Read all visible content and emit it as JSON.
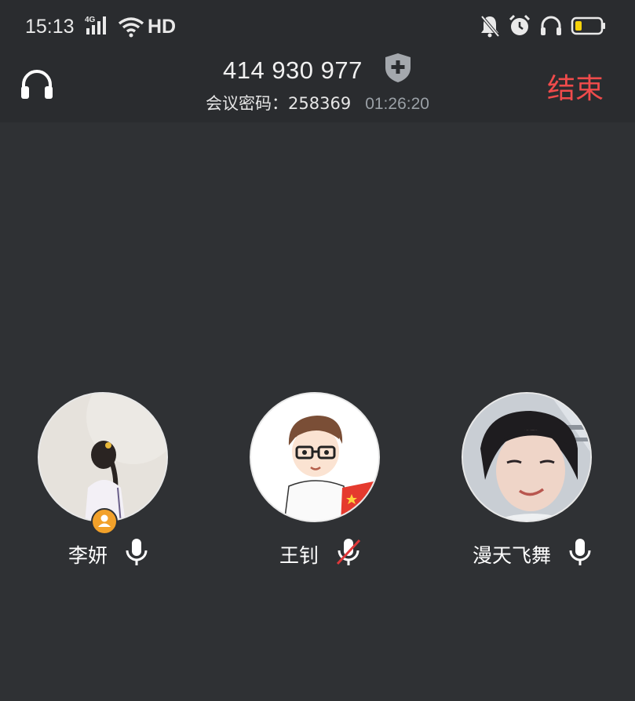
{
  "status_bar": {
    "time": "15:13",
    "network": "4G",
    "hd": "HD",
    "icons": [
      "signal-icon",
      "wifi-icon",
      "mute-notification-icon",
      "alarm-icon",
      "headset-icon",
      "battery-icon"
    ],
    "battery_color": "#f5d20b"
  },
  "header": {
    "meeting_id": "414 930 977",
    "password_label": "会议密码：",
    "password": "258369",
    "duration": "01:26:20",
    "end_label": "结束",
    "end_color": "#f04b4b"
  },
  "participants": [
    {
      "name": "李妍",
      "mic": "on",
      "is_host": true
    },
    {
      "name": "王钊",
      "mic": "muted",
      "is_host": false
    },
    {
      "name": "漫天飞舞",
      "mic": "on",
      "is_host": false
    }
  ],
  "colors": {
    "background": "#2f3134",
    "header_bg": "#2a2c2f",
    "host_badge": "#f2a12a"
  }
}
